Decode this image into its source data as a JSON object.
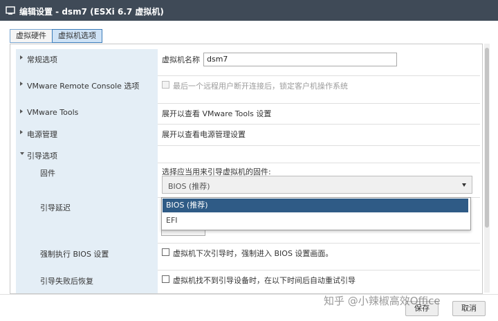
{
  "window": {
    "title": "编辑设置 - dsm7 (ESXi 6.7 虚拟机)"
  },
  "tabs": [
    {
      "label": "虚拟硬件",
      "active": false
    },
    {
      "label": "虚拟机选项",
      "active": true
    }
  ],
  "sections": {
    "general": {
      "label": "常规选项",
      "vm_name_label": "虚拟机名称",
      "vm_name_value": "dsm7"
    },
    "vmrc": {
      "label": "VMware Remote Console 选项",
      "checkbox_label": "最后一个远程用户断开连接后，锁定客户机操作系统",
      "checked": false,
      "disabled": true
    },
    "vmtools": {
      "label": "VMware Tools",
      "value": "展开以查看 VMware Tools 设置"
    },
    "power": {
      "label": "电源管理",
      "value": "展开以查看电源管理设置"
    },
    "boot": {
      "label": "引导选项",
      "firmware": {
        "label": "固件",
        "prompt": "选择应当用来引导虚拟机的固件:",
        "selected": "BIOS (推荐)",
        "options": [
          "BIOS (推荐)",
          "EFI"
        ]
      },
      "boot_delay": {
        "label": "引导延迟"
      },
      "force_bios": {
        "label": "强制执行 BIOS 设置",
        "checkbox_label": "虚拟机下次引导时，强制进入 BIOS 设置画面。",
        "checked": false
      },
      "failed_recovery": {
        "label": "引导失败后恢复",
        "checkbox_label": "虚拟机找不到引导设备时，在以下时间后自动重试引导",
        "checked": false
      }
    }
  },
  "footer": {
    "save_label": "保存",
    "cancel_label": "取消"
  },
  "watermark": "知乎 @小辣椒高效Office",
  "colors": {
    "titlebar": "#3f4a57",
    "label_column": "#e4eef6",
    "selected_option": "#2f5b86",
    "active_tab": "#cfe3f6"
  },
  "icons": {
    "app": "vm-settings-icon",
    "expand": "chevron-right-icon",
    "collapse": "chevron-down-icon",
    "select": "caret-down-icon"
  }
}
